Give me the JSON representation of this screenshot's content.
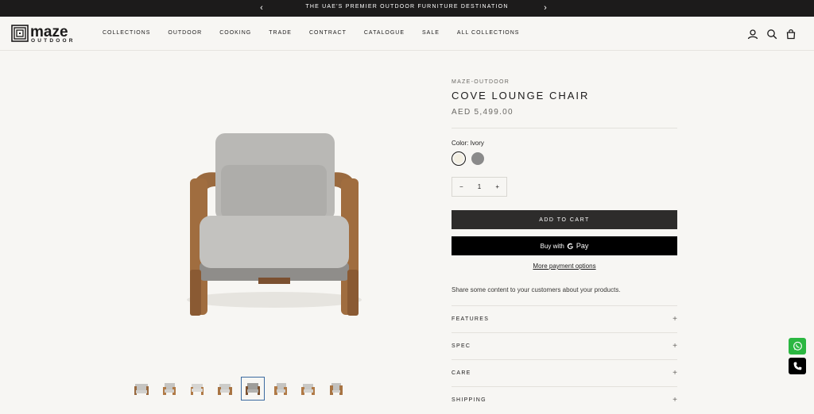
{
  "announcement": {
    "text": "THE UAE'S PREMIER OUTDOOR FURNITURE DESTINATION",
    "prev_icon": "chevron-left-icon",
    "next_icon": "chevron-right-icon"
  },
  "header": {
    "logo_top": "maze",
    "logo_bottom": "OUTDOOR",
    "nav": [
      "COLLECTIONS",
      "OUTDOOR",
      "COOKING",
      "TRADE",
      "CONTRACT",
      "CATALOGUE",
      "SALE",
      "ALL COLLECTIONS"
    ],
    "icons": [
      "account-icon",
      "search-icon",
      "cart-icon"
    ]
  },
  "product": {
    "vendor": "MAZE-OUTDOOR",
    "title": "COVE LOUNGE CHAIR",
    "price": "AED 5,499.00",
    "color_label": "Color: Ivory",
    "swatches": [
      {
        "name": "Ivory",
        "color": "#f3efe2",
        "selected": true
      },
      {
        "name": "Grey",
        "color": "#8a8a8a",
        "selected": false
      }
    ],
    "quantity": "1",
    "minus": "−",
    "plus": "+",
    "add_to_cart": "ADD TO CART",
    "buy_with": "Buy with",
    "gpay": "Pay",
    "more_payment": "More payment options",
    "description": "Share some content to your customers about your products.",
    "accordions": [
      "FEATURES",
      "SPEC",
      "CARE",
      "SHIPPING"
    ]
  },
  "gallery": {
    "thumb_count": 8,
    "active_index": 4
  },
  "floating": {
    "whatsapp_color": "#2bb741",
    "call_color": "#000000"
  }
}
